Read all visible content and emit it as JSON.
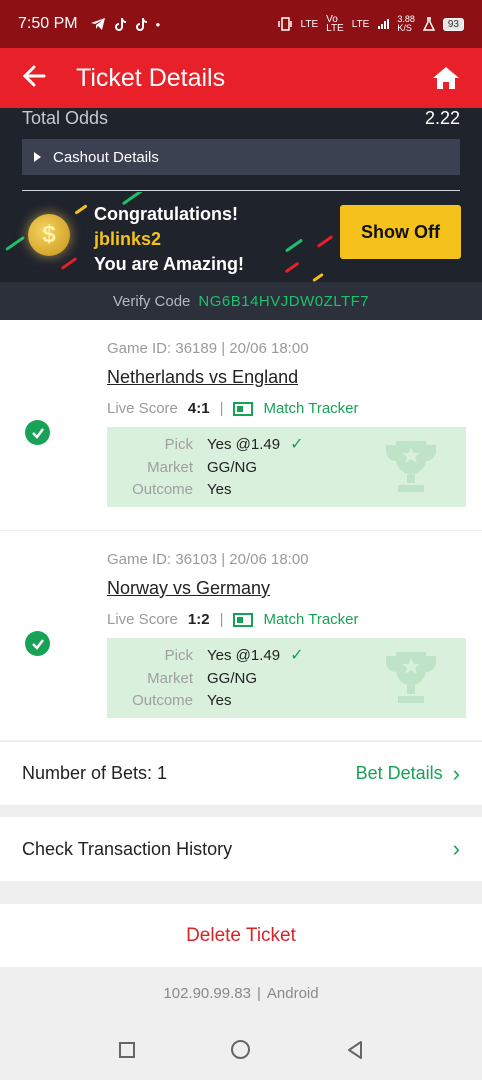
{
  "status_bar": {
    "time": "7:50 PM",
    "battery": "93",
    "speed": "3.88\nK/S",
    "net1": "LTE",
    "net2": "Vo\nLTE",
    "net3": "LTE"
  },
  "header": {
    "title": "Ticket Details"
  },
  "odds": {
    "label": "Total Odds",
    "value": "2.22"
  },
  "cashout": {
    "label": "Cashout Details"
  },
  "congrats": {
    "line1": "Congratulations!",
    "username": "jblinks2",
    "line3": "You are Amazing!",
    "button": "Show Off",
    "coin_symbol": "$"
  },
  "verify": {
    "label": "Verify Code",
    "code": "NG6B14HVJDW0ZLTF7"
  },
  "bets": [
    {
      "game_id": "Game ID: 36189 | 20/06 18:00",
      "teams": "Netherlands vs England",
      "live_label": "Live Score",
      "score": "4:1",
      "tracker": "Match Tracker",
      "pick_label": "Pick",
      "pick": "Yes @1.49",
      "market_label": "Market",
      "market": "GG/NG",
      "outcome_label": "Outcome",
      "outcome": "Yes"
    },
    {
      "game_id": "Game ID: 36103 | 20/06 18:00",
      "teams": "Norway vs Germany",
      "live_label": "Live Score",
      "score": "1:2",
      "tracker": "Match Tracker",
      "pick_label": "Pick",
      "pick": "Yes @1.49",
      "market_label": "Market",
      "market": "GG/NG",
      "outcome_label": "Outcome",
      "outcome": "Yes"
    }
  ],
  "summary": {
    "num_bets": "Number of Bets: 1",
    "bet_details": "Bet Details"
  },
  "transaction": {
    "label": "Check Transaction History"
  },
  "delete": {
    "label": "Delete Ticket"
  },
  "footer": {
    "ip": "102.90.99.83",
    "platform": "Android"
  },
  "colors": {
    "accent_red": "#e8202a",
    "status_red": "#8d1015",
    "green": "#17a257",
    "gold": "#f4c21b",
    "dark": "#1f232c"
  }
}
